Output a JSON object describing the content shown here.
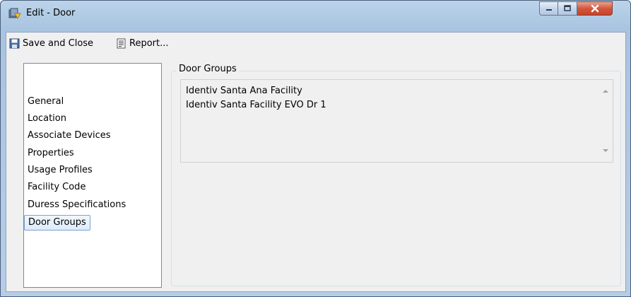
{
  "window": {
    "title": "Edit - Door",
    "controls": {
      "minimize": "minimize",
      "maximize": "maximize",
      "close": "close"
    }
  },
  "toolbar": {
    "save_close_label": "Save and Close",
    "report_label": "Report..."
  },
  "nav": {
    "items": [
      {
        "label": "General"
      },
      {
        "label": "Location"
      },
      {
        "label": "Associate Devices"
      },
      {
        "label": "Properties"
      },
      {
        "label": "Usage Profiles"
      },
      {
        "label": "Facility Code"
      },
      {
        "label": "Duress Specifications"
      },
      {
        "label": "Door Groups"
      }
    ],
    "selected": "Door Groups"
  },
  "main": {
    "group_title": "Door Groups",
    "door_groups": [
      "Identiv Santa Ana Facility",
      "Identiv Santa Facility EVO Dr 1"
    ]
  },
  "colors": {
    "selection_border": "#7da2ce",
    "selection_fill": "#dcebfc",
    "close_button": "#c7432b"
  }
}
